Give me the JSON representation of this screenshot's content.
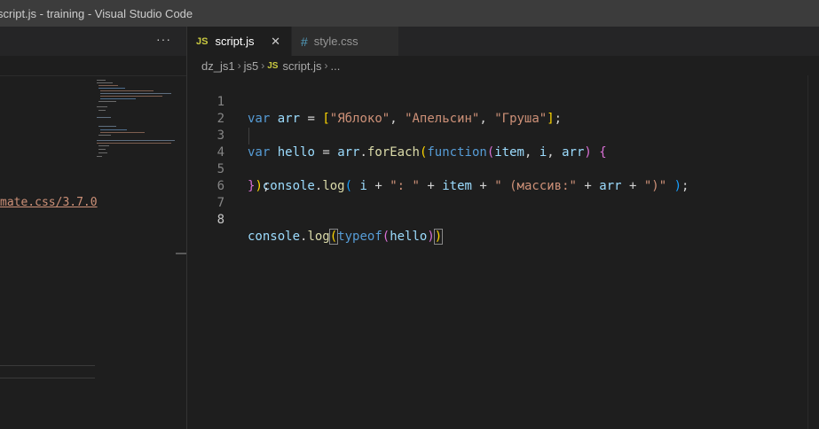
{
  "window": {
    "title": "script.js - training - Visual Studio Code"
  },
  "left_panel": {
    "more_label": "···",
    "link_text": "mate.css/3.7.0"
  },
  "tabs": [
    {
      "icon": "JS",
      "label": "script.js",
      "close": "✕",
      "active": true
    },
    {
      "icon": "#",
      "label": "style.css",
      "active": false
    }
  ],
  "breadcrumbs": {
    "items": [
      "dz_js1",
      "js5",
      "script.js",
      "..."
    ],
    "separator": "›",
    "file_icon": "JS"
  },
  "editor": {
    "current_line": 8,
    "line_numbers": [
      "1",
      "2",
      "3",
      "4",
      "5",
      "6",
      "7",
      "8"
    ],
    "code": {
      "l1": {
        "kw": "var",
        "sp1": " ",
        "name": "arr",
        "eq": " = ",
        "ob": "[",
        "s1": "\"Яблоко\"",
        "c1": ", ",
        "s2": "\"Апельсин\"",
        "c2": ", ",
        "s3": "\"Груша\"",
        "cb": "]",
        "semi": ";"
      },
      "l3": {
        "kw": "var",
        "sp1": " ",
        "name": "hello",
        "eq": " = ",
        "obj": "arr",
        "dot": ".",
        "method": "forEach",
        "op": "(",
        "fkw": "function",
        "p_open": "(",
        "p1": "item",
        "pc1": ", ",
        "p2": "i",
        "pc2": ", ",
        "p3": "arr",
        "p_close": ")",
        "sp2": " ",
        "brace": "{"
      },
      "l4": {
        "indent": "  ",
        "obj": "console",
        "dot": ".",
        "method": "log",
        "op": "(",
        "sp": " ",
        "v1": "i",
        "plus1": " + ",
        "s1": "\": \"",
        "plus2": " + ",
        "v2": "item",
        "plus3": " + ",
        "s2": "\" (массив:\"",
        "plus4": " + ",
        "v3": "arr",
        "plus5": " + ",
        "s3": "\")\"",
        "sp2": " ",
        "cp": ")",
        "semi": ";"
      },
      "l5": {
        "brace": "}",
        "paren": ")",
        "semi": ";"
      },
      "l8": {
        "obj": "console",
        "dot": ".",
        "method": "log",
        "op1": "(",
        "fn": "typeof",
        "op2": "(",
        "arg": "hello",
        "cp2": ")",
        "cp1": ")"
      }
    }
  },
  "colors": {
    "keyword": "#569cd6",
    "variable": "#9cdcfe",
    "string": "#ce9178",
    "function": "#dcdcaa",
    "bracket_level1": "#ffd700",
    "bracket_level2": "#da70d6",
    "bracket_level3": "#179fff",
    "editor_bg": "#1e1e1e",
    "titlebar_bg": "#3c3c3c"
  }
}
